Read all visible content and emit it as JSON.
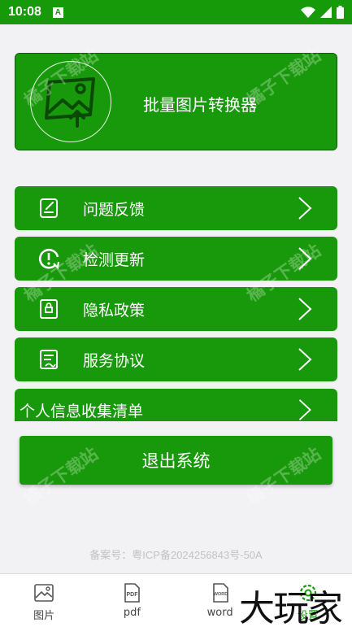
{
  "status_bar": {
    "time": "10:08",
    "notification_glyph": "A"
  },
  "header": {
    "title": "批量图片转换器",
    "logo_icon": "image-convert-icon"
  },
  "menu": [
    {
      "label": "问题反馈",
      "icon": "feedback-icon"
    },
    {
      "label": "检测更新",
      "icon": "update-icon"
    },
    {
      "label": "隐私政策",
      "icon": "privacy-icon"
    },
    {
      "label": "服务协议",
      "icon": "agreement-icon"
    },
    {
      "label": "个人信息收集清单"
    }
  ],
  "logout_label": "退出系统",
  "icp": "备案号：粤ICP备2024256843号-50A",
  "bottom_nav": [
    {
      "label": "图片",
      "icon": "image-icon"
    },
    {
      "label": "pdf",
      "icon": "pdf-icon",
      "icon_text": "PDF"
    },
    {
      "label": "word",
      "icon": "word-icon",
      "icon_text": "WORD"
    },
    {
      "label": "设置",
      "icon": "settings-icon"
    }
  ],
  "watermark_text": "橘子下载站",
  "brand_overlay": "大玩家",
  "colors": {
    "primary": "#18990b",
    "status_bar": "#169a0a",
    "background": "#f2f2f4"
  }
}
